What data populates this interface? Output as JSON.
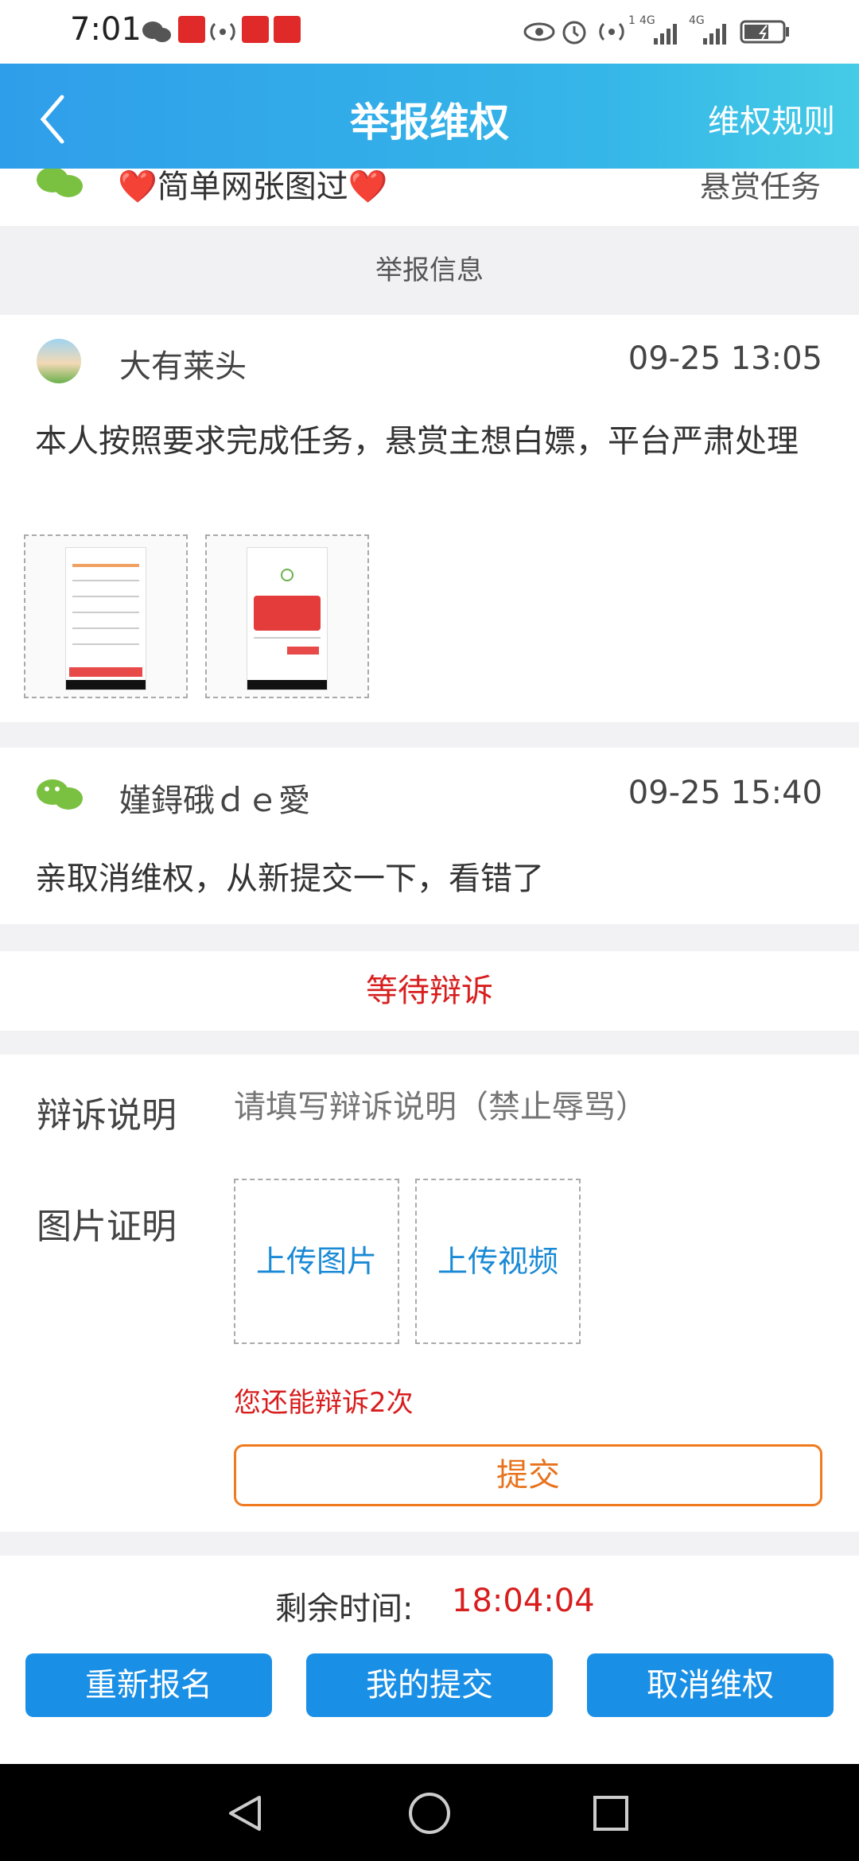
{
  "status_bar": {
    "time": "7:01",
    "signal_labels": [
      "1",
      "4G",
      "4G"
    ]
  },
  "header": {
    "title": "举报维权",
    "rules_label": "维权规则"
  },
  "task": {
    "name": "❤️简单网张图过❤️",
    "type": "悬赏任务"
  },
  "section_label": "举报信息",
  "report": {
    "user": "大有莱头",
    "time": "09-25 13:05",
    "text": "本人按照要求完成任务，悬赏主想白嫖，平台严肃处理"
  },
  "reply": {
    "user": "嫤鍀硪ｄｅ愛",
    "time": "09-25 15:40",
    "text": "亲取消维权，从新提交一下，看错了"
  },
  "status_text": "等待辩诉",
  "defense": {
    "label": "辩诉说明",
    "placeholder": "请填写辩诉说明（禁止辱骂）",
    "image_label": "图片证明",
    "upload_image": "上传图片",
    "upload_video": "上传视频",
    "remaining": "您还能辩诉2次",
    "submit": "提交"
  },
  "footer": {
    "countdown_label": "剩余时间:",
    "countdown_value": "18:04:04",
    "buttons": [
      "重新报名",
      "我的提交",
      "取消维权"
    ]
  },
  "colors": {
    "header_start": "#2f9eea",
    "header_end": "#45cbe6",
    "accent_blue": "#1a8fe6",
    "alert_red": "#d81e1e",
    "submit_orange": "#e8721c"
  },
  "icons": [
    "back-icon",
    "wechat-icon",
    "avatar",
    "triangle-back-nav-icon",
    "circle-home-nav-icon",
    "square-recents-nav-icon"
  ]
}
